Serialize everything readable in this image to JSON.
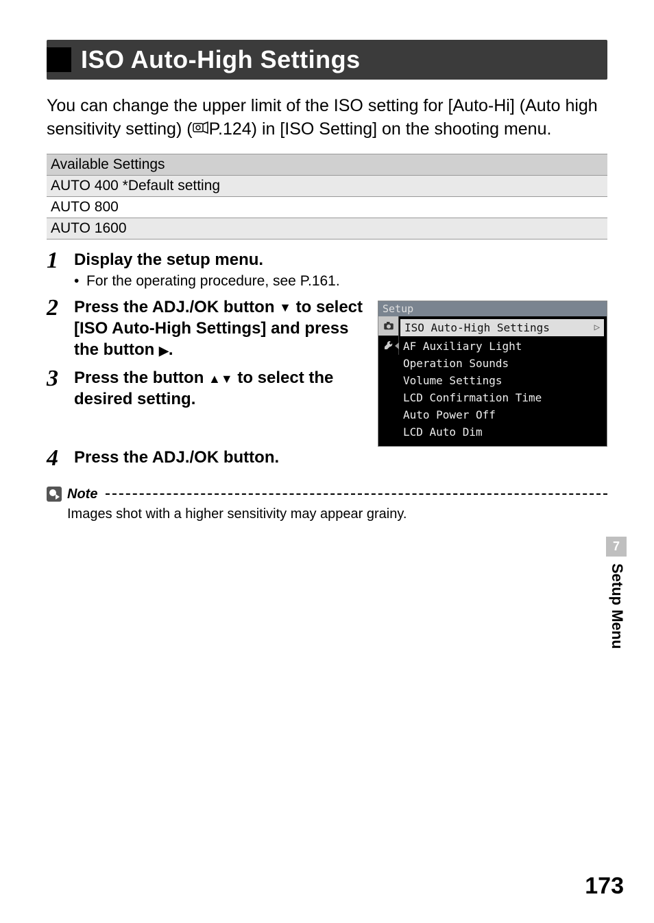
{
  "heading": "ISO Auto-High Settings",
  "intro_1": "You can change the upper limit of the ISO setting for [Auto-Hi] (Auto high sensitivity setting) (",
  "intro_ref": "P.124",
  "intro_2": ") in [ISO Setting] on the shooting menu.",
  "table": {
    "header": "Available Settings",
    "rows": [
      "AUTO 400 *Default setting",
      "AUTO 800",
      "AUTO 1600"
    ]
  },
  "steps": [
    {
      "num": "1",
      "title": "Display the setup menu.",
      "sub": "For the operating procedure, see P.161."
    },
    {
      "num": "2",
      "title_a": "Press the ADJ./OK button ",
      "title_b": " to select [ISO Auto-High Settings] and press the button ",
      "title_c": "."
    },
    {
      "num": "3",
      "title_a": "Press the button ",
      "title_b": " to select the desired setting."
    },
    {
      "num": "4",
      "title": "Press the ADJ./OK button."
    }
  ],
  "lcd": {
    "title": "Setup",
    "items": [
      "ISO Auto-High Settings",
      "AF Auxiliary Light",
      "Operation Sounds",
      "Volume Settings",
      "LCD Confirmation Time",
      "Auto Power Off",
      "LCD Auto Dim"
    ]
  },
  "note": {
    "label": "Note",
    "text": "Images shot with a higher sensitivity may appear grainy."
  },
  "side": {
    "chapter": "7",
    "label": "Setup Menu"
  },
  "page_number": "173"
}
